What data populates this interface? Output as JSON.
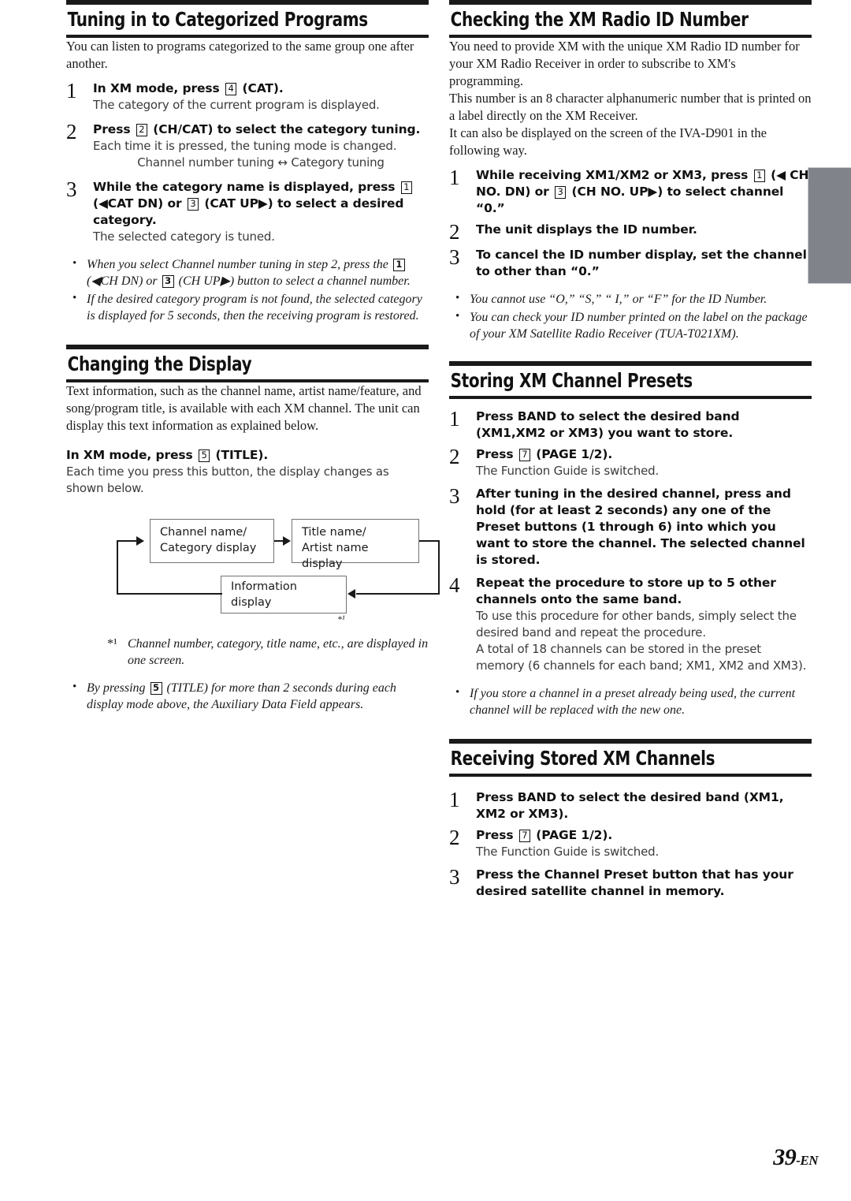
{
  "page": {
    "number": "39",
    "number_suffix": "-EN"
  },
  "left_column": {
    "section1": {
      "heading": "Tuning in to Categorized Programs",
      "intro": "You can listen to programs categorized to the same group one after another.",
      "steps": [
        {
          "num": "1",
          "title_pre": "In XM mode, press",
          "key": "4",
          "title_post": "(CAT).",
          "notes": [
            "The category of the current program is displayed."
          ]
        },
        {
          "num": "2",
          "title_pre": "Press",
          "key": "2",
          "title_post": "(CH/CAT) to select the category tuning.",
          "notes": [
            "Each time it is pressed, the tuning mode is changed.",
            "Channel number tuning ↔ Category tuning"
          ]
        },
        {
          "num": "3",
          "title_line1_pre": "While the category name is displayed, press",
          "key1": "1",
          "title_line2_pre": "(◀CAT DN) or",
          "key2": "3",
          "title_line2_post": "(CAT UP▶) to select a desired category.",
          "notes": [
            "The selected category is tuned."
          ]
        }
      ],
      "bullets": [
        {
          "pre": "When you select Channel number tuning in step 2, press the",
          "key1": "1",
          "mid1": "(◀CH DN) or",
          "key2": "3",
          "mid2": "(CH UP▶) button to select a channel number."
        },
        {
          "text": "If the desired category program is not found, the selected category is displayed for 5 seconds, then the receiving program is restored."
        }
      ]
    },
    "section2": {
      "heading": "Changing the Display",
      "intro": "Text information, such as the channel name, artist name/feature, and song/program title, is available with each XM channel. The unit can display this text information as explained below.",
      "instruction_pre": "In XM mode, press",
      "instruction_key": "5",
      "instruction_post": "(TITLE).",
      "instruction_note": "Each time you press this button, the display changes as shown below.",
      "diagram": {
        "box1_line1": "Channel name/",
        "box1_line2": "Category display",
        "box2_line1": "Title name/",
        "box2_line2": "Artist name display",
        "box3": "Information display",
        "star": "*¹"
      },
      "footnote": {
        "mark": "*¹",
        "text": "Channel number, category, title name, etc., are displayed in one screen."
      },
      "bullet": {
        "pre": "By pressing",
        "key": "5",
        "post": "(TITLE) for more than 2 seconds during each display mode above, the Auxiliary Data Field appears."
      }
    }
  },
  "right_column": {
    "section3": {
      "heading": "Checking the XM Radio ID Number",
      "paragraph1": "You need to provide XM with the unique XM Radio ID number for your XM Radio Receiver in order to subscribe to XM's programming.",
      "paragraph2": "This number is an 8 character alphanumeric number that is printed on a label directly on the XM Receiver.",
      "paragraph3": "It can also be displayed on the screen of the IVA-D901 in the following way.",
      "steps": [
        {
          "num": "1",
          "line1_pre": "While receiving XM1/XM2 or XM3, press",
          "key1": "1",
          "line1_post": "(◀ CH",
          "line2_pre": "NO. DN) or",
          "key2": "3",
          "line2_post": "(CH NO. UP▶) to select channel",
          "line3": "“0.”"
        },
        {
          "num": "2",
          "title": "The unit displays the ID number."
        },
        {
          "num": "3",
          "title": "To cancel the ID number display, set the channel to other than “0.”"
        }
      ],
      "bullets": [
        "You cannot use “O,” “S,” “ I,” or “F” for the ID Number.",
        "You can check your ID number printed on the label on the package of your XM Satellite Radio Receiver (TUA-T021XM)."
      ]
    },
    "section4": {
      "heading": "Storing XM Channel Presets",
      "steps": [
        {
          "num": "1",
          "title_pre": "Press",
          "bold": "BAND",
          "title_post": "to select the desired band (XM1,XM2 or XM3) you want to store."
        },
        {
          "num": "2",
          "title_pre": "Press",
          "key": "7",
          "title_post": "(PAGE 1/2).",
          "note": "The Function Guide is switched."
        },
        {
          "num": "3",
          "part1": "After tuning in the desired channel, press and hold (for at least 2 seconds) any one of the ",
          "bold": "Preset buttons (1 through 6)",
          "part2": " into which you want to store the channel. The selected channel is stored."
        },
        {
          "num": "4",
          "title": "Repeat the procedure to store up to 5 other channels onto the same band.",
          "notes": [
            "To use this procedure for other bands, simply select the desired band and repeat the procedure.",
            "A total of 18 channels can be stored in the preset memory (6 channels for each band; XM1, XM2 and XM3)."
          ]
        }
      ],
      "bullet": "If you store a channel in a preset already being used, the current channel will be replaced with the new one."
    },
    "section5": {
      "heading": "Receiving Stored XM Channels",
      "steps": [
        {
          "num": "1",
          "title_pre": "Press",
          "bold": "BAND",
          "title_post": "to select the desired band (XM1, XM2 or XM3)."
        },
        {
          "num": "2",
          "title_pre": "Press",
          "key": "7",
          "title_post": "(PAGE 1/2).",
          "note": "The Function Guide is switched."
        },
        {
          "num": "3",
          "title_pre": "Press the",
          "bold": "Channel Preset",
          "title_post": "button that has your desired satellite channel in memory."
        }
      ]
    }
  }
}
